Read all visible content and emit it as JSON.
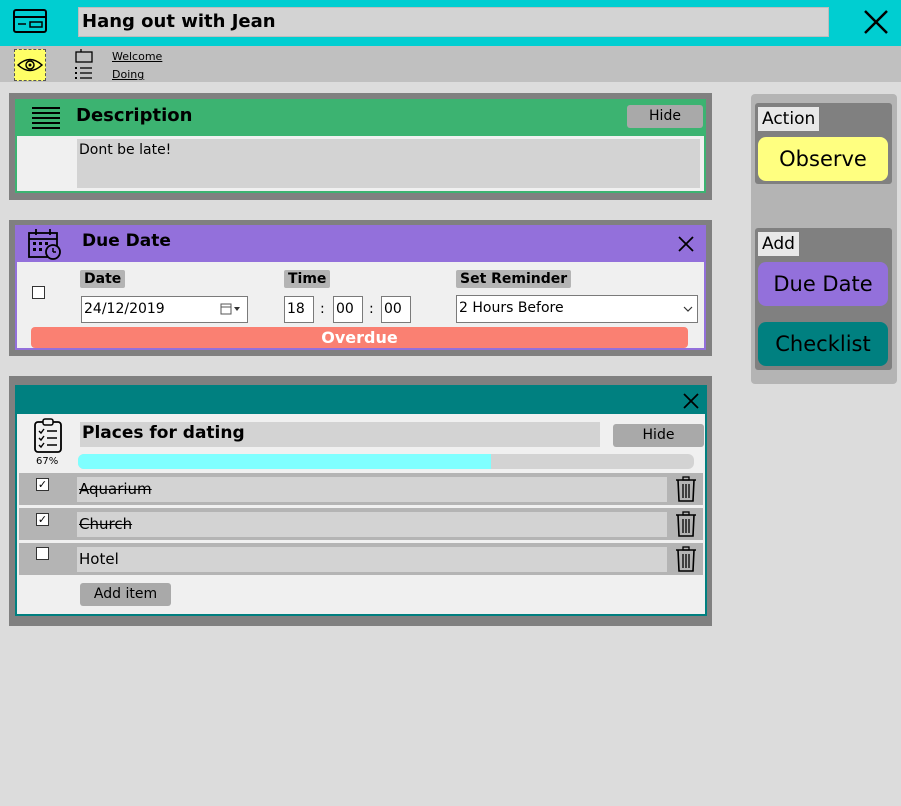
{
  "header": {
    "title": "Hang out with Jean"
  },
  "breadcrumb": {
    "board": "Welcome",
    "list": "Doing"
  },
  "description": {
    "title": "Description",
    "hide_label": "Hide",
    "text": "Dont be late!"
  },
  "due_date": {
    "title": "Due Date",
    "date_label": "Date",
    "time_label": "Time",
    "reminder_label": "Set Reminder",
    "date_value": "24/12/2019",
    "hour": "18",
    "minute": "00",
    "second": "00",
    "time_separator": ":",
    "reminder_value": "2 Hours Before",
    "status": "Overdue",
    "status_color": "#fa8072",
    "completed": false
  },
  "checklist": {
    "title": "Places for dating",
    "hide_label": "Hide",
    "progress_text": "67%",
    "progress_fraction": 0.67,
    "items": [
      {
        "text": "Aquarium",
        "checked": true
      },
      {
        "text": "Church",
        "checked": true
      },
      {
        "text": "Hotel",
        "checked": false
      }
    ],
    "add_item_label": "Add item"
  },
  "side": {
    "action_label": "Action",
    "observe_label": "Observe",
    "add_label": "Add",
    "due_date_label": "Due Date",
    "checklist_label": "Checklist"
  },
  "colors": {
    "header": "#00ced1",
    "description": "#3cb371",
    "due_date": "#9370db",
    "checklist": "#008080",
    "observe": "#ffff80",
    "progress": "#7fffff"
  }
}
